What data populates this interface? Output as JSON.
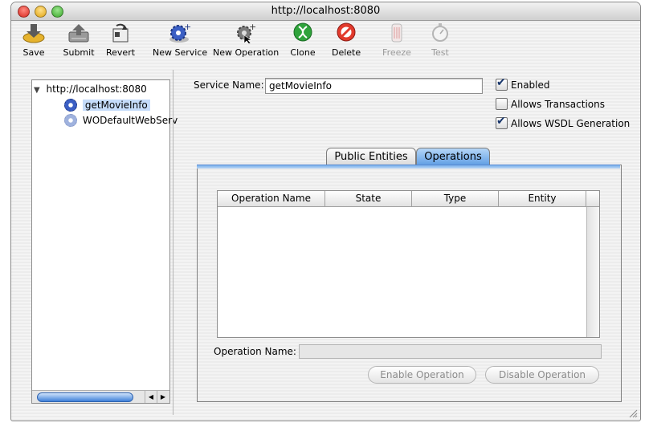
{
  "window": {
    "title": "http://localhost:8080"
  },
  "toolbar": {
    "items": [
      {
        "label": "Save",
        "icon": "save-icon",
        "enabled": true
      },
      {
        "label": "Submit",
        "icon": "submit-icon",
        "enabled": true
      },
      {
        "label": "Revert",
        "icon": "revert-icon",
        "enabled": true
      },
      {
        "label": "New Service",
        "icon": "new-service-icon",
        "enabled": true
      },
      {
        "label": "New Operation",
        "icon": "new-operation-icon",
        "enabled": true
      },
      {
        "label": "Clone",
        "icon": "clone-icon",
        "enabled": true
      },
      {
        "label": "Delete",
        "icon": "delete-icon",
        "enabled": true
      },
      {
        "label": "Freeze",
        "icon": "freeze-icon",
        "enabled": false
      },
      {
        "label": "Test",
        "icon": "test-icon",
        "enabled": false
      }
    ]
  },
  "tree": {
    "root": "http://localhost:8080",
    "children": [
      {
        "label": "getMovieInfo",
        "selected": true
      },
      {
        "label": "WODefaultWebServ",
        "selected": false
      }
    ]
  },
  "service": {
    "name_label": "Service Name:",
    "name_value": "getMovieInfo",
    "enabled_label": "Enabled",
    "enabled": true,
    "transactions_label": "Allows Transactions",
    "transactions": false,
    "wsdl_label": "Allows WSDL Generation",
    "wsdl": true
  },
  "tabs": [
    {
      "label": "Public Entities",
      "selected": false
    },
    {
      "label": "Operations",
      "selected": true
    }
  ],
  "operations": {
    "columns": [
      "Operation Name",
      "State",
      "Type",
      "Entity"
    ],
    "rows": [],
    "name_label": "Operation Name:",
    "name_value": "",
    "enable_button": "Enable Operation",
    "disable_button": "Disable Operation"
  },
  "colors": {
    "selection": "#c5dcfa",
    "tab_selected": "#5b9be3",
    "disabled_text": "#8c8c8c"
  }
}
